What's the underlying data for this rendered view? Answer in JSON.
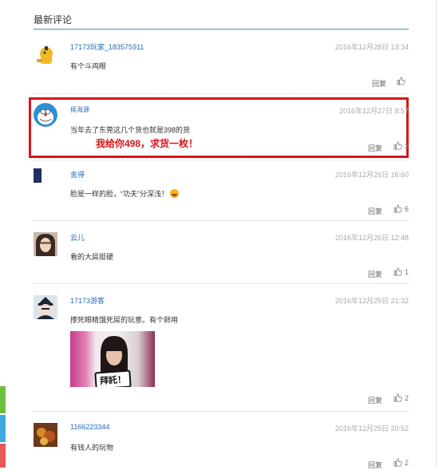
{
  "section_title": "最新评论",
  "reply_label": "回复",
  "comments": [
    {
      "user": "17173玩家_183575911",
      "date": "2016年12月28日 13:34",
      "text": "有个斗鸡眼",
      "likes": ""
    },
    {
      "user": "侯海源",
      "date": "2016年12月27日 8:57",
      "text": "当年去了东莞这几个货也就是398的货",
      "likes": "3"
    },
    {
      "user": "舍得",
      "date": "2016年12月26日 16:60",
      "text": "脸是一样的脸，“功夫”分深浅！",
      "likes": "6"
    },
    {
      "user": "云儿",
      "date": "2016年12月26日 12:48",
      "text": "看的大屌挺硬",
      "likes": "1"
    },
    {
      "user": "17173游客",
      "date": "2016年12月25日 21:32",
      "text": "撑死眼睛饿死屌的玩意。有个卵用",
      "likes": "2"
    },
    {
      "user": "1166223344",
      "date": "2016年12月25日 20:52",
      "text": "有钱人的玩物",
      "likes": "2"
    }
  ],
  "annotation": "我给你498，求货一枚！",
  "meme_text": "拜託！",
  "colors": {
    "accent": "#3b8fd6",
    "highlight": "#d9141c",
    "link": "#2a6ab5"
  },
  "icons": [
    "thumbs-up-icon",
    "grin-emoji-icon"
  ]
}
